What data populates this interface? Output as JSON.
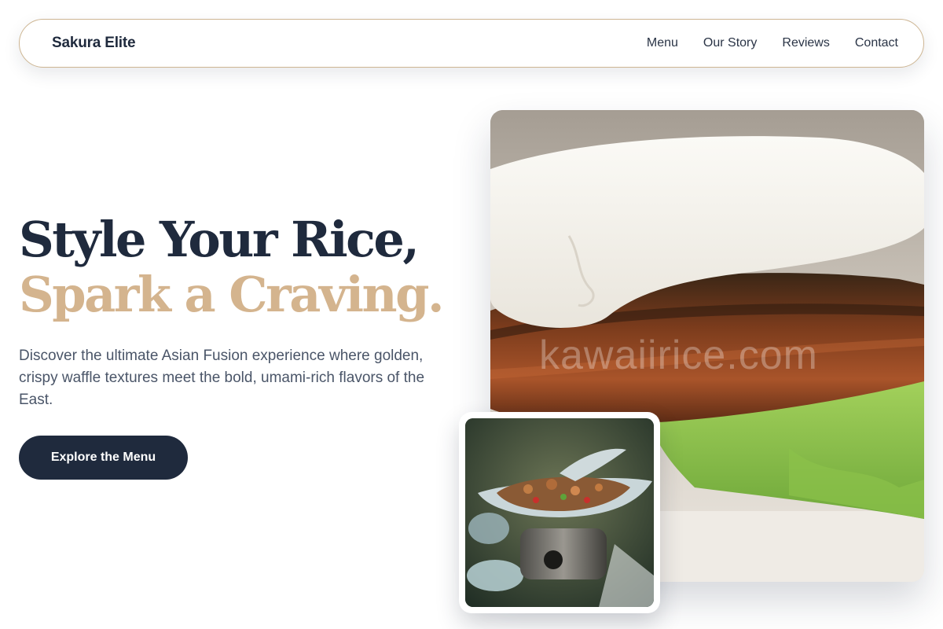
{
  "nav": {
    "brand": "Sakura Elite",
    "links": [
      "Menu",
      "Our Story",
      "Reviews",
      "Contact"
    ]
  },
  "hero": {
    "headline_line1": "Style Your Rice,",
    "headline_line2": "Spark a Craving.",
    "description": "Discover the ultimate Asian Fusion experience where golden, crispy waffle textures meet the bold, umami-rich flavors of the East.",
    "cta_label": "Explore the Menu"
  },
  "images": {
    "main_watermark": "kawaiirice.com"
  },
  "colors": {
    "primary_navy": "#1f2a3d",
    "accent_gold": "#d4b48e",
    "body_text": "#4a5568",
    "nav_border": "#cdb592"
  }
}
